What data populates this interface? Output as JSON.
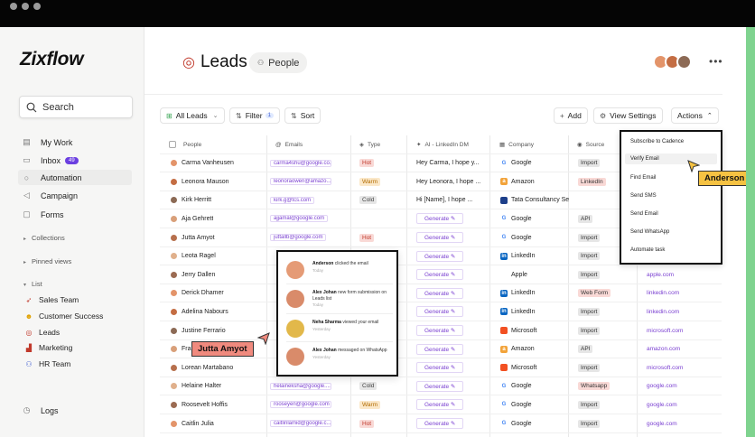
{
  "app": {
    "logo": "Zixflow"
  },
  "sidebar": {
    "search_label": "Search",
    "nav": [
      {
        "label": "My Work",
        "icon": "stack-icon"
      },
      {
        "label": "Inbox",
        "icon": "inbox-icon",
        "badge": "49"
      },
      {
        "label": "Automation",
        "icon": "bulb-icon"
      },
      {
        "label": "Campaign",
        "icon": "megaphone-icon"
      },
      {
        "label": "Forms",
        "icon": "form-icon"
      }
    ],
    "collections_label": "Collections",
    "pinned_label": "Pinned views",
    "list_label": "List",
    "lists": [
      {
        "label": "Sales Team",
        "icon": "rocket-icon"
      },
      {
        "label": "Customer Success",
        "icon": "smile-icon"
      },
      {
        "label": "Leads",
        "icon": "target-icon"
      },
      {
        "label": "Marketing",
        "icon": "chart-icon"
      },
      {
        "label": "HR Team",
        "icon": "people-icon"
      }
    ],
    "logs_label": "Logs"
  },
  "header": {
    "title": "Leads",
    "people_button": "People"
  },
  "toolbar": {
    "all_leads": "All Leads",
    "filter": "Filter",
    "filter_count": "1",
    "sort": "Sort",
    "add": "Add",
    "view_settings": "View Settings",
    "actions": "Actions"
  },
  "table": {
    "columns": [
      "People",
      "Emails",
      "Type",
      "AI - LinkedIn DM",
      "Company",
      "Source"
    ],
    "rows": [
      {
        "name": "Carma Vanheusen",
        "email": "carma4shu@google.co...",
        "type": "Hot",
        "dm": "Hey Carma, I hope y...",
        "company": "Google",
        "source": "Import",
        "link": ""
      },
      {
        "name": "Leonora Mauson",
        "email": "leonoraowen@amazo...",
        "type": "Warm",
        "dm": "Hey Leonora, I hope ...",
        "company": "Amazon",
        "source": "LinkedIn",
        "link": ""
      },
      {
        "name": "Kirk Herritt",
        "email": "kirk.g@tcs.com",
        "type": "Cold",
        "dm": "Hi [Name], I hope ...",
        "company": "Tata Consultancy Se",
        "source": "",
        "link": ""
      },
      {
        "name": "Aja Gehrett",
        "email": "ajjamal@google.com",
        "type": "",
        "dm": "Generate",
        "company": "Google",
        "source": "API",
        "link": ""
      },
      {
        "name": "Jutta Amyot",
        "email": "juttallb@google.com",
        "type": "Hot",
        "dm": "Generate",
        "company": "Google",
        "source": "Import",
        "link": ""
      },
      {
        "name": "Leota Ragel",
        "email": "",
        "type": "",
        "dm": "Generate",
        "company": "LinkedIn",
        "source": "Import",
        "link": ""
      },
      {
        "name": "Jerry Dallen",
        "email": "",
        "type": "",
        "dm": "Generate",
        "company": "Apple",
        "source": "Import",
        "link": "apple.com"
      },
      {
        "name": "Derick Dhamer",
        "email": "",
        "type": "",
        "dm": "Generate",
        "company": "LinkedIn",
        "source": "Web Form",
        "link": "linkedin.com"
      },
      {
        "name": "Adelina Nabours",
        "email": "",
        "type": "",
        "dm": "Generate",
        "company": "LinkedIn",
        "source": "Import",
        "link": "linkedin.com"
      },
      {
        "name": "Justine Ferrario",
        "email": "",
        "type": "",
        "dm": "Generate",
        "company": "Microsoft",
        "source": "Import",
        "link": "microsoft.com"
      },
      {
        "name": "Fran",
        "email": "",
        "type": "",
        "dm": "Generate",
        "company": "Amazon",
        "source": "API",
        "link": "amazon.com"
      },
      {
        "name": "Lorean Martabano",
        "email": "",
        "type": "",
        "dm": "Generate",
        "company": "Microsoft",
        "source": "Import",
        "link": "microsoft.com"
      },
      {
        "name": "Helaine Halter",
        "email": "helaineksha@google....",
        "type": "Cold",
        "dm": "Generate",
        "company": "Google",
        "source": "Whatsapp",
        "link": "google.com"
      },
      {
        "name": "Roosevelt Hoffis",
        "email": "rooseyen@google.com",
        "type": "Warm",
        "dm": "Generate",
        "company": "Google",
        "source": "Import",
        "link": "google.com"
      },
      {
        "name": "Caitlin Julia",
        "email": "caitlinlamid@google.c...",
        "type": "Hot",
        "dm": "Generate",
        "company": "Google",
        "source": "Import",
        "link": "google.com"
      }
    ]
  },
  "actions_menu": {
    "items": [
      "Subscribe to Cadence",
      "Verify Email",
      "Find Email",
      "Send SMS",
      "Send Email",
      "Send WhatsApp",
      "Automate task"
    ],
    "highlighted": "Verify Email"
  },
  "cursors": {
    "anderson": "Anderson",
    "jutta": "Jutta Amyot"
  },
  "notifications": [
    {
      "name": "Anderson",
      "text": "clicked the email",
      "time": "Today"
    },
    {
      "name": "Alex Johan",
      "text": "new form submission on Leads list",
      "time": "Today"
    },
    {
      "name": "Neha Sharma",
      "text": "viewed your email",
      "time": "Yesterday"
    },
    {
      "name": "Alex Johan",
      "text": "messaged on WhatsApp",
      "time": "Yesterday"
    }
  ],
  "colors": {
    "accent": "#6b3fe0",
    "hot": "#f9d9d6",
    "warm": "#fbe8c9",
    "cold": "#e6e6e6",
    "cursor_orange": "#f5c242",
    "cursor_red": "#f08a7e"
  }
}
